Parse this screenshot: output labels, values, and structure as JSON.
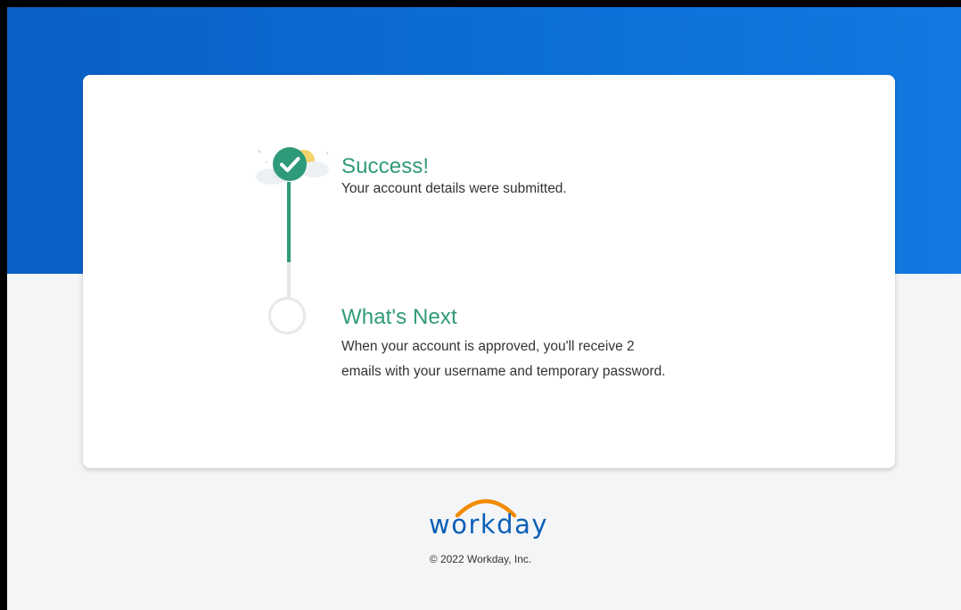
{
  "success": {
    "title": "Success!",
    "message": "Your account details were submitted."
  },
  "next": {
    "title": "What's Next",
    "line1": "When your account is approved, you'll receive 2",
    "line2": "emails with your username and temporary password."
  },
  "footer": {
    "brand": "workday",
    "copyright": "© 2022 Workday, Inc."
  },
  "colors": {
    "brand_blue": "#0b6fd6",
    "success_green": "#2f9a79",
    "logo_orange": "#f38b00",
    "page_bg": "#f4f5f7"
  },
  "icons": [
    "success-illustration-icon",
    "check-icon",
    "empty-step-circle-icon",
    "workday-arc-icon"
  ]
}
